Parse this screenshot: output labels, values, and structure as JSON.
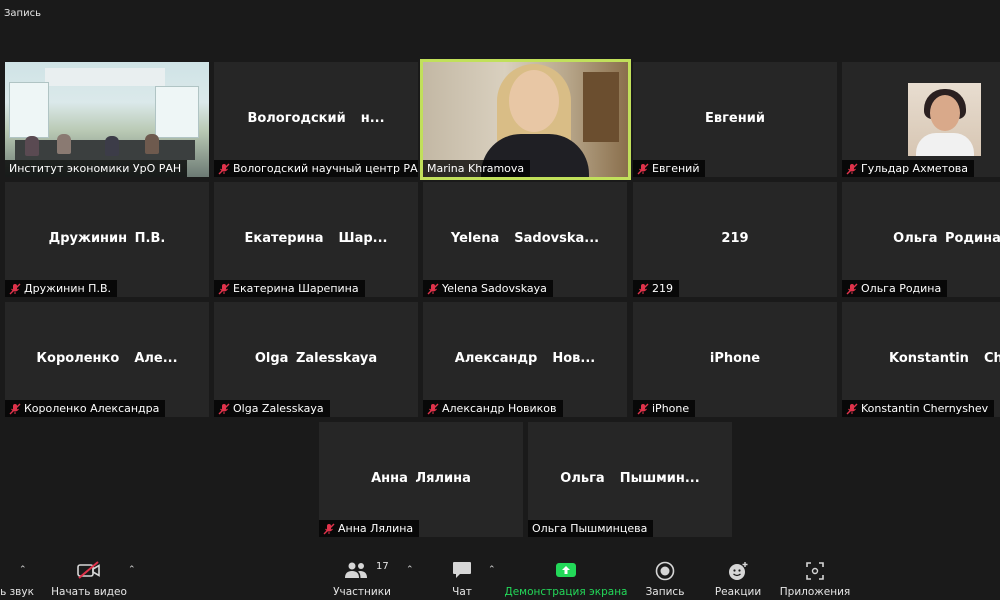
{
  "recording_label": "Запись",
  "active_speaker": "Marina Khramova",
  "tiles": [
    {
      "name": "",
      "label": "Институт экономики УрО РАН",
      "muted": false,
      "video": "room"
    },
    {
      "name": "Вологодский  н...",
      "label": "Вологодский научный центр РАН",
      "muted": true
    },
    {
      "name": "",
      "label": "Marina Khramova",
      "muted": false,
      "video": "marina",
      "active": true
    },
    {
      "name": "Евгений",
      "label": "Евгений",
      "muted": true
    },
    {
      "name": "",
      "label": "Гульдар Ахметова",
      "muted": true,
      "video": "avatar"
    },
    {
      "name": "Дружинин П.В.",
      "label": "Дружинин П.В.",
      "muted": true
    },
    {
      "name": "Екатерина  Шар...",
      "label": "Екатерина Шарепина",
      "muted": true
    },
    {
      "name": "Yelena  Sadovska...",
      "label": "Yelena Sadovskaya",
      "muted": true
    },
    {
      "name": "219",
      "label": "219",
      "muted": true
    },
    {
      "name": "Ольга Родина",
      "label": "Ольга Родина",
      "muted": true
    },
    {
      "name": "Короленко  Але...",
      "label": "Короленко Александра",
      "muted": true
    },
    {
      "name": "Olga Zalesskaya",
      "label": "Olga Zalesskaya",
      "muted": true
    },
    {
      "name": "Александр  Нов...",
      "label": "Александр Новиков",
      "muted": true
    },
    {
      "name": "iPhone",
      "label": "iPhone",
      "muted": true
    },
    {
      "name": "Konstantin  Cher...",
      "label": "Konstantin Chernyshev",
      "muted": true
    },
    {
      "name": "Анна Лялина",
      "label": "Анна Лялина",
      "muted": true
    },
    {
      "name": "Ольга  Пышмин...",
      "label": "Ольга Пышминцева",
      "muted": false
    }
  ],
  "toolbar": {
    "audio_label": "ь звук",
    "video_label": "Начать видео",
    "participants_label": "Участники",
    "participants_count": "17",
    "chat_label": "Чат",
    "share_label": "Демонстрация экрана",
    "record_label": "Запись",
    "reactions_label": "Реакции",
    "apps_label": "Приложения"
  },
  "colors": {
    "active_border": "#c1e05b",
    "share_green": "#23d959",
    "muted_red": "#e0334b"
  }
}
